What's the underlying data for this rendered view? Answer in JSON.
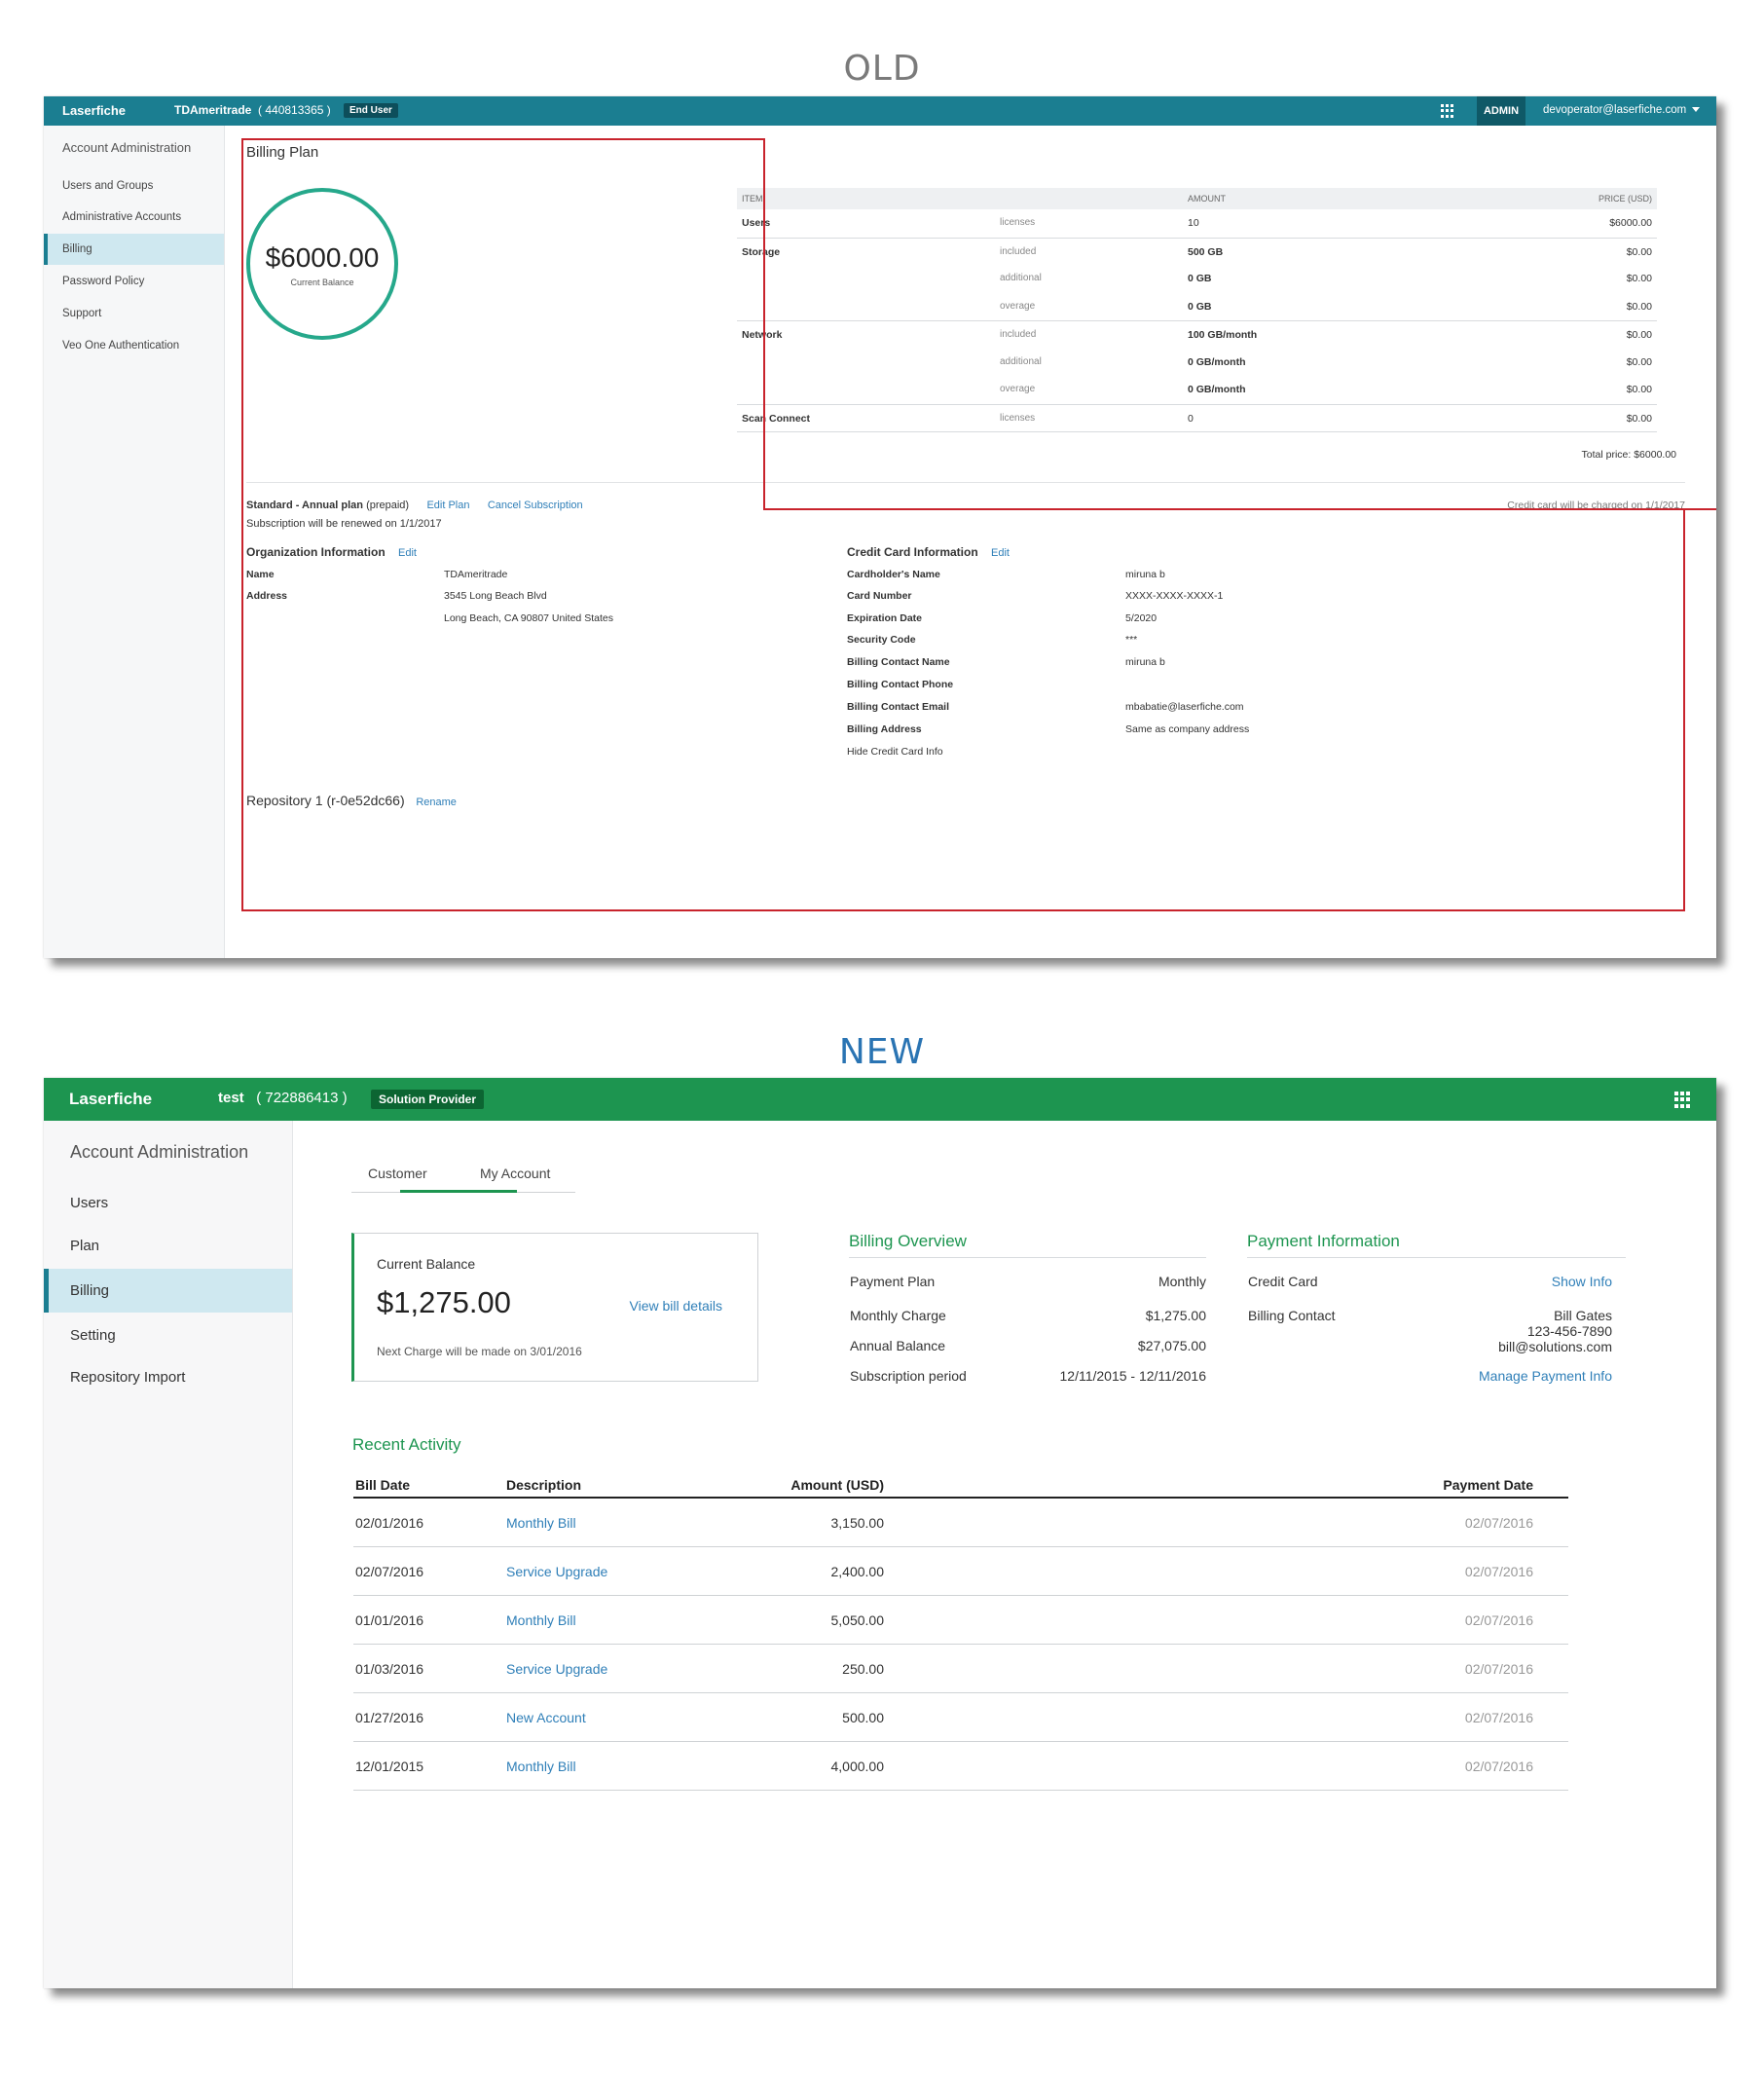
{
  "headings": {
    "old": "OLD",
    "new": "NEW"
  },
  "old": {
    "topbar": {
      "brand": "Laserfiche",
      "org": "TDAmeritrade",
      "org_id": "( 440813365 )",
      "role": "End User",
      "admin": "ADMIN",
      "user": "devoperator@laserfiche.com"
    },
    "sidebar": {
      "header": "Account Administration",
      "items": [
        "Users and Groups",
        "Administrative Accounts",
        "Billing",
        "Password Policy",
        "Support",
        "Veo One Authentication"
      ]
    },
    "billing": {
      "title": "Billing Plan",
      "balance": "$6000.00",
      "balance_label": "Current Balance",
      "table_headers": {
        "item": "ITEM",
        "amount": "AMOUNT",
        "price": "PRICE (USD)"
      },
      "rows": [
        {
          "item": "Users",
          "sub": "licenses",
          "amount": "10",
          "price": "$6000.00"
        },
        {
          "item": "Storage",
          "sub": "included",
          "amount": "500 GB",
          "price": "$0.00"
        },
        {
          "item": "",
          "sub": "additional",
          "amount": "0 GB",
          "price": "$0.00"
        },
        {
          "item": "",
          "sub": "overage",
          "amount": "0 GB",
          "price": "$0.00"
        },
        {
          "item": "Network",
          "sub": "included",
          "amount": "100 GB/month",
          "price": "$0.00"
        },
        {
          "item": "",
          "sub": "additional",
          "amount": "0 GB/month",
          "price": "$0.00"
        },
        {
          "item": "",
          "sub": "overage",
          "amount": "0 GB/month",
          "price": "$0.00"
        },
        {
          "item": "Scan Connect",
          "sub": "licenses",
          "amount": "0",
          "price": "$0.00"
        }
      ],
      "total": "Total price: $6000.00",
      "plan_name": "Standard - Annual plan",
      "plan_type": "(prepaid)",
      "edit_plan": "Edit Plan",
      "cancel": "Cancel Subscription",
      "renewal": "Subscription will be renewed on 1/1/2017",
      "charged_note": "Credit card will be charged on 1/1/2017"
    },
    "org_info": {
      "title": "Organization Information",
      "edit": "Edit",
      "name_label": "Name",
      "name": "TDAmeritrade",
      "address_label": "Address",
      "address1": "3545 Long Beach Blvd",
      "address2": "Long Beach, CA 90807 United States"
    },
    "card_info": {
      "title": "Credit Card Information",
      "edit": "Edit",
      "fields": [
        {
          "label": "Cardholder's Name",
          "value": "miruna b"
        },
        {
          "label": "Card Number",
          "value": "XXXX-XXXX-XXXX-1"
        },
        {
          "label": "Expiration Date",
          "value": "5/2020"
        },
        {
          "label": "Security Code",
          "value": "***"
        },
        {
          "label": "Billing Contact Name",
          "value": "miruna b"
        },
        {
          "label": "Billing Contact Phone",
          "value": ""
        },
        {
          "label": "Billing Contact Email",
          "value": "mbabatie@laserfiche.com"
        },
        {
          "label": "Billing Address",
          "value": "Same as company address"
        }
      ],
      "hide_link": "Hide Credit Card Info"
    },
    "repository": {
      "name": "Repository 1 (r-0e52dc66)",
      "rename": "Rename"
    },
    "highlight_color": "#c8232c"
  },
  "new": {
    "topbar": {
      "brand": "Laserfiche",
      "org": "test",
      "org_id": "( 722886413 )",
      "role": "Solution Provider"
    },
    "sidebar": {
      "header": "Account Administration",
      "items": [
        "Users",
        "Plan",
        "Billing",
        "Setting",
        "Repository Import"
      ]
    },
    "tabs": [
      "Customer",
      "My Account"
    ],
    "balance": {
      "label": "Current Balance",
      "amount": "$1,275.00",
      "link": "View bill details",
      "next_charge": "Next Charge will be made on 3/01/2016"
    },
    "overview": {
      "title": "Billing Overview",
      "rows": [
        {
          "label": "Payment Plan",
          "value": "Monthly"
        },
        {
          "label": "Monthly Charge",
          "value": "$1,275.00"
        },
        {
          "label": "Annual Balance",
          "value": "$27,075.00"
        },
        {
          "label": "Subscription period",
          "value": "12/11/2015 - 12/11/2016"
        }
      ]
    },
    "payment": {
      "title": "Payment Information",
      "card_label": "Credit Card",
      "show_info": "Show Info",
      "contact_label": "Billing Contact",
      "contact_name": "Bill Gates",
      "contact_phone": "123-456-7890",
      "contact_email": "bill@solutions.com",
      "manage": "Manage Payment Info"
    },
    "activity": {
      "title": "Recent Activity",
      "headers": {
        "bill_date": "Bill Date",
        "description": "Description",
        "amount": "Amount (USD)",
        "payment_date": "Payment Date"
      },
      "rows": [
        {
          "bill_date": "02/01/2016",
          "description": "Monthly Bill",
          "amount": "3,150.00",
          "payment_date": "02/07/2016"
        },
        {
          "bill_date": "02/07/2016",
          "description": "Service Upgrade",
          "amount": "2,400.00",
          "payment_date": "02/07/2016"
        },
        {
          "bill_date": "01/01/2016",
          "description": "Monthly Bill",
          "amount": "5,050.00",
          "payment_date": "02/07/2016"
        },
        {
          "bill_date": "01/03/2016",
          "description": "Service Upgrade",
          "amount": "250.00",
          "payment_date": "02/07/2016"
        },
        {
          "bill_date": "01/27/2016",
          "description": "New Account",
          "amount": "500.00",
          "payment_date": "02/07/2016"
        },
        {
          "bill_date": "12/01/2015",
          "description": "Monthly Bill",
          "amount": "4,000.00",
          "payment_date": "02/07/2016"
        }
      ]
    },
    "accent": "#1d9550"
  }
}
